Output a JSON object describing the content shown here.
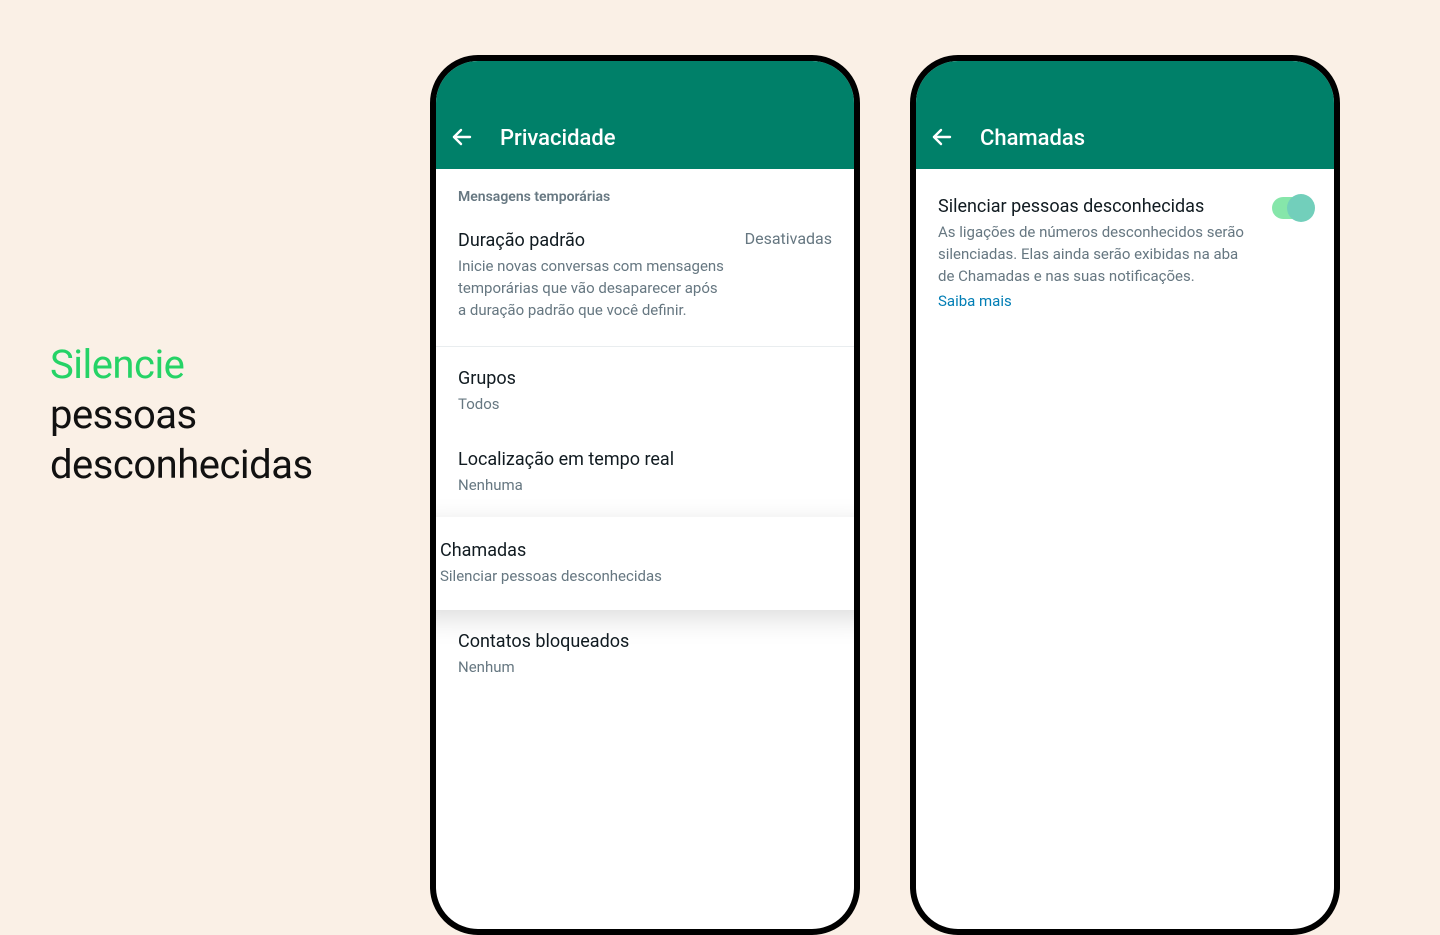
{
  "headline": {
    "line1": "Silencie",
    "line2": "pessoas",
    "line3": "desconhecidas"
  },
  "phoneLeft": {
    "appbar_title": "Privacidade",
    "section_header": "Mensagens temporárias",
    "duration": {
      "title": "Duração padrão",
      "value": "Desativadas",
      "desc": "Inicie novas conversas com mensagens temporárias que vão desaparecer após a duração padrão que você definir."
    },
    "groups": {
      "title": "Grupos",
      "desc": "Todos"
    },
    "location": {
      "title": "Localização em tempo real",
      "desc": "Nenhuma"
    },
    "calls": {
      "title": "Chamadas",
      "desc": "Silenciar pessoas desconhecidas"
    },
    "blocked": {
      "title": "Contatos bloqueados",
      "desc": "Nenhum"
    }
  },
  "phoneRight": {
    "appbar_title": "Chamadas",
    "silence": {
      "title": "Silenciar pessoas desconhecidas",
      "desc": "As ligações de números desconhecidos serão silenciadas. Elas ainda serão exibidas na aba de Chamadas e nas suas notificações.",
      "link": "Saiba mais"
    }
  }
}
